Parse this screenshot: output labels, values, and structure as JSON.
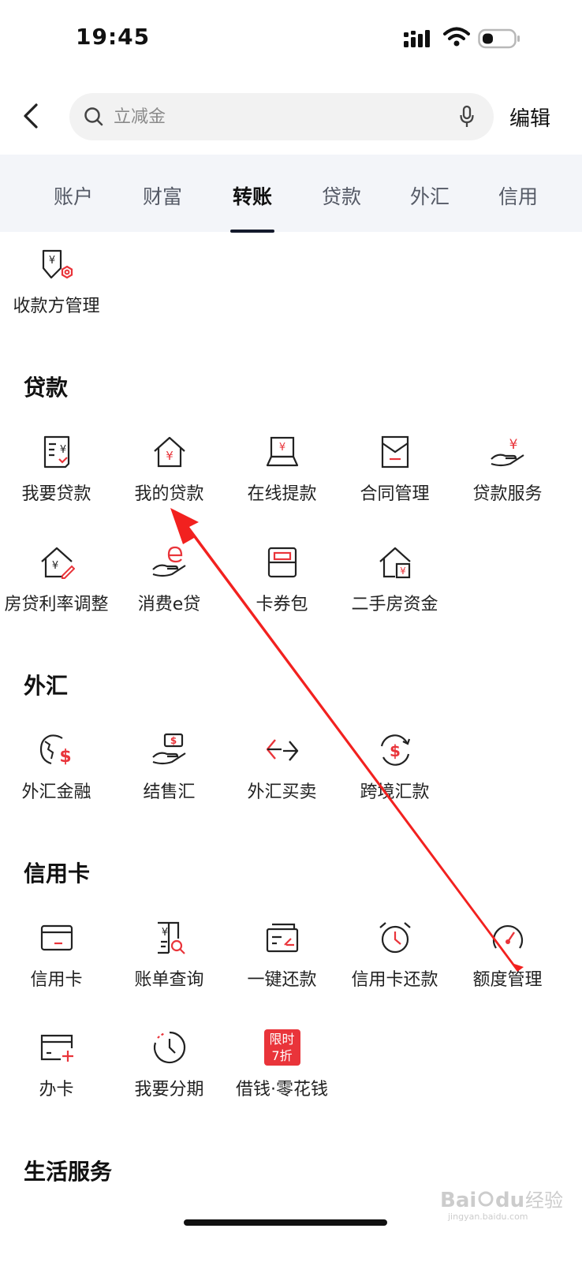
{
  "status_bar": {
    "time": "19:45"
  },
  "search": {
    "placeholder": "立减金",
    "edit_label": "编辑"
  },
  "tabs": [
    "账户",
    "财富",
    "转账",
    "贷款",
    "外汇",
    "信用"
  ],
  "active_tab": "转账",
  "transfer": {
    "items": [
      {
        "label": "收款方管理",
        "icon": "payee-management-icon"
      }
    ]
  },
  "loans": {
    "title": "贷款",
    "items": [
      {
        "label": "我要贷款",
        "icon": "loan-apply-icon"
      },
      {
        "label": "我的贷款",
        "icon": "house-yuan-icon"
      },
      {
        "label": "在线提款",
        "icon": "laptop-withdraw-icon"
      },
      {
        "label": "合同管理",
        "icon": "contract-icon"
      },
      {
        "label": "贷款服务",
        "icon": "hand-yuan-icon"
      },
      {
        "label": "房贷利率调整",
        "icon": "house-edit-icon"
      },
      {
        "label": "消费e贷",
        "icon": "hand-e-icon"
      },
      {
        "label": "卡券包",
        "icon": "coupon-wallet-icon"
      },
      {
        "label": "二手房资金",
        "icon": "second-hand-house-icon"
      }
    ]
  },
  "forex": {
    "title": "外汇",
    "items": [
      {
        "label": "外汇金融",
        "icon": "globe-dollar-icon"
      },
      {
        "label": "结售汇",
        "icon": "hand-dollar-icon"
      },
      {
        "label": "外汇买卖",
        "icon": "exchange-arrows-icon"
      },
      {
        "label": "跨境汇款",
        "icon": "cross-border-remit-icon"
      }
    ]
  },
  "credit_card": {
    "title": "信用卡",
    "items": [
      {
        "label": "信用卡",
        "icon": "credit-card-icon"
      },
      {
        "label": "账单查询",
        "icon": "bill-search-icon"
      },
      {
        "label": "一键还款",
        "icon": "one-click-repay-icon"
      },
      {
        "label": "信用卡还款",
        "icon": "alarm-clock-icon"
      },
      {
        "label": "额度管理",
        "icon": "gauge-icon"
      },
      {
        "label": "办卡",
        "icon": "card-add-icon"
      },
      {
        "label": "我要分期",
        "icon": "installment-clock-icon"
      },
      {
        "label": "借钱·零花钱",
        "icon": "promo-badge-icon",
        "badge_line1": "限时",
        "badge_line2": "7折"
      }
    ]
  },
  "life_services": {
    "title": "生活服务"
  },
  "colors": {
    "accent_red": "#e9343a",
    "arrow_red": "#f2211f",
    "tab_bg": "#f3f5f9"
  },
  "watermark": {
    "text": "Baidu经验",
    "sub": "jingyan.baidu.com"
  }
}
